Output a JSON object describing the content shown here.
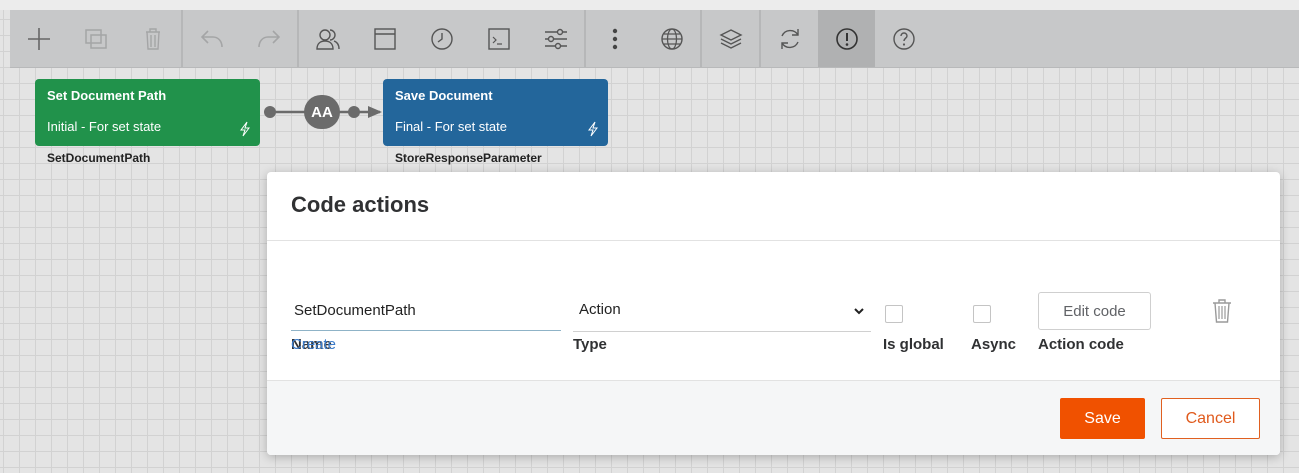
{
  "toolbar": {
    "icons": [
      "add-icon",
      "copy-icon",
      "delete-icon",
      "undo-icon",
      "redo-icon",
      "users-icon",
      "window-icon",
      "clock-icon",
      "terminal-icon",
      "sliders-icon",
      "more-vertical-icon",
      "globe-icon",
      "layers-icon",
      "refresh-icon",
      "warning-circle-icon",
      "help-icon"
    ]
  },
  "canvas": {
    "node1": {
      "title": "Set Document Path",
      "subtitle": "Initial - For set state",
      "label": "SetDocumentPath",
      "color": "#21924b"
    },
    "node2": {
      "title": "Save Document",
      "subtitle": "Final - For set state",
      "label": "StoreResponseParameter",
      "color": "#23669b"
    },
    "connector_label": "AA"
  },
  "dialog": {
    "title": "Code actions",
    "columns": {
      "name": "Name",
      "type": "Type",
      "is_global": "Is global",
      "async": "Async",
      "action_code": "Action code"
    },
    "row": {
      "name_value": "SetDocumentPath",
      "type_value": "Action",
      "is_global": false,
      "async": false,
      "edit_code_label": "Edit code"
    },
    "create_label": "Create",
    "save_label": "Save",
    "cancel_label": "Cancel"
  },
  "colors": {
    "accent": "#f05100",
    "link": "#3d7cc9"
  }
}
